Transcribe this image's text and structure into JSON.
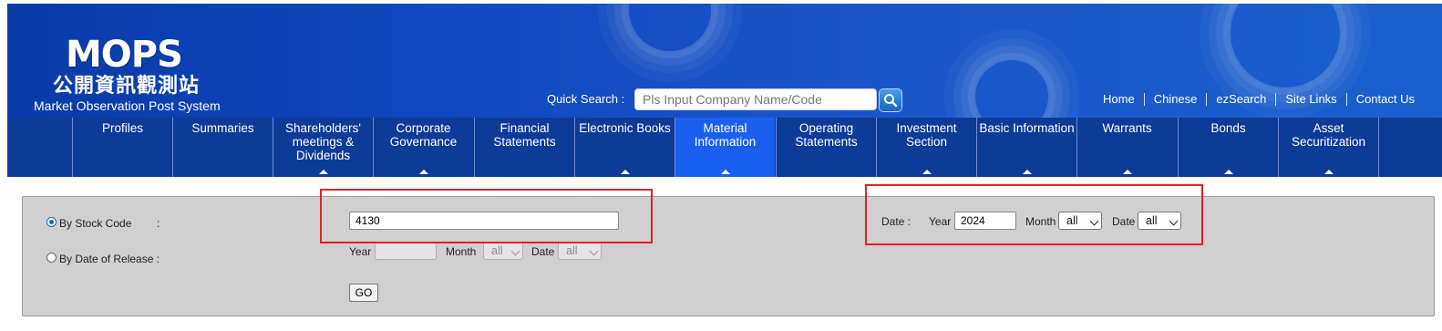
{
  "header": {
    "logo_main": "MOPS",
    "logo_cn": "公開資訊觀測站",
    "logo_en": "Market Observation Post System",
    "quick_search_label": "Quick Search :",
    "quick_search_placeholder": "Pls Input Company Name/Code",
    "top_links": [
      "Home",
      "Chinese",
      "ezSearch",
      "Site Links",
      "Contact Us"
    ]
  },
  "nav": {
    "items": [
      {
        "label": "Profiles"
      },
      {
        "label": "Summaries"
      },
      {
        "label": "Shareholders' meetings & Dividends"
      },
      {
        "label": "Corporate Governance"
      },
      {
        "label": "Financial Statements"
      },
      {
        "label": "Electronic Books"
      },
      {
        "label": "Material Information"
      },
      {
        "label": "Operating Statements"
      },
      {
        "label": "Investment Section"
      },
      {
        "label": "Basic Information"
      },
      {
        "label": "Warrants"
      },
      {
        "label": "Bonds"
      },
      {
        "label": "Asset Securitization"
      }
    ],
    "active_index": 6
  },
  "form": {
    "by_stock_code_label": "By Stock Code",
    "colon": ":",
    "by_date_label": "By Date of Release :",
    "stock_code_value": "4130",
    "release_year_label": "Year",
    "release_month_label": "Month",
    "release_month_value": "all",
    "release_date_label": "Date",
    "release_date_value": "all",
    "go_label": "GO",
    "date_label": "Date :",
    "year_label": "Year",
    "year_value": "2024",
    "month_label": "Month",
    "month_value": "all",
    "day_label": "Date",
    "day_value": "all"
  },
  "colors": {
    "header_blue": "#1148c0",
    "nav_blue": "#0d3b98",
    "nav_active": "#1a5ff0",
    "highlight_red": "#e0202a",
    "panel_gray": "#d0d0d0"
  }
}
